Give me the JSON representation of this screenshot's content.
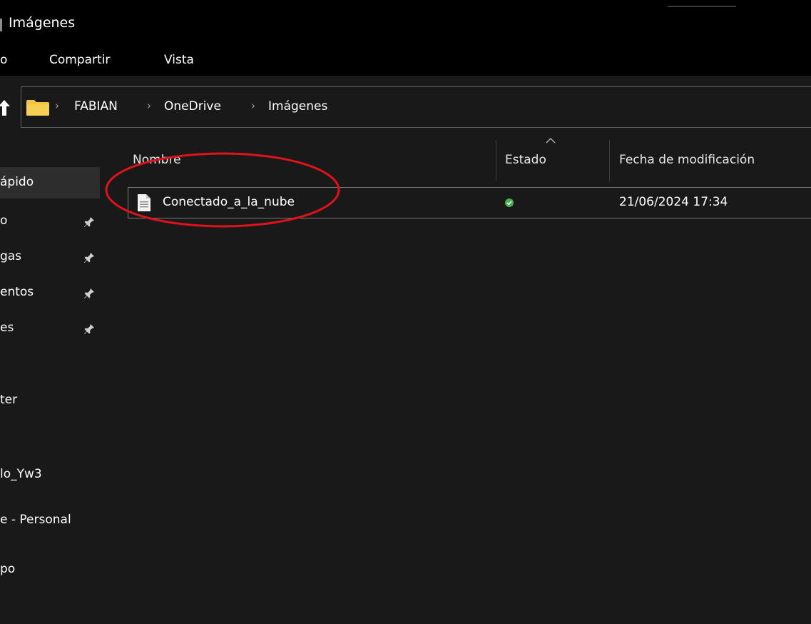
{
  "window": {
    "title": "Imágenes"
  },
  "ribbon": {
    "tabs": [
      {
        "label": "o"
      },
      {
        "label": "Compartir"
      },
      {
        "label": "Vista"
      }
    ]
  },
  "address": {
    "crumbs": [
      "FABIAN",
      "OneDrive",
      "Imágenes"
    ],
    "separator": "›"
  },
  "sidebar": {
    "items": [
      {
        "label": "ápido",
        "pinned": false,
        "selected": true
      },
      {
        "label": "o",
        "pinned": true
      },
      {
        "label": "gas",
        "pinned": true
      },
      {
        "label": "entos",
        "pinned": true
      },
      {
        "label": "es",
        "pinned": true
      },
      {
        "label": "ter",
        "pinned": false
      },
      {
        "label": "lo_Yw3",
        "pinned": false
      },
      {
        "label": "e - Personal",
        "pinned": false
      },
      {
        "label": "po",
        "pinned": false
      }
    ]
  },
  "columns": {
    "name": "Nombre",
    "status": "Estado",
    "date": "Fecha de modificación"
  },
  "files": [
    {
      "name": "Conectado_a_la_nube",
      "status_icon": "check-circle-icon",
      "date": "21/06/2024 17:34"
    }
  ],
  "colors": {
    "background": "#191919",
    "titlebar": "#000000",
    "annotation": "#e0121b",
    "status_ok": "#4caf50",
    "folder": "#f5c242"
  }
}
